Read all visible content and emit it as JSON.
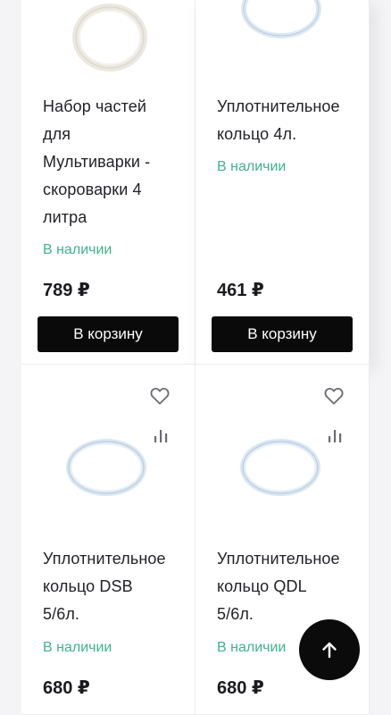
{
  "products": [
    {
      "title": "Набор частей для Мультиварки - скороварки 4 литра",
      "title_lines": [
        "Набор частей",
        "для",
        "Мультиварки -",
        "скороварки 4",
        "литра"
      ],
      "stock": "В наличии",
      "price": "789 ₽",
      "button": "В корзину",
      "image_icon": "seal-ring-icon"
    },
    {
      "title": "Уплотнительное кольцо 4л.",
      "title_lines": [
        "Уплотнительное",
        "кольцо 4л."
      ],
      "stock": "В наличии",
      "price": "461 ₽",
      "button": "В корзину",
      "image_icon": "seal-ring-icon"
    },
    {
      "title": "Уплотнительное кольцо DSB 5/6л.",
      "title_lines": [
        "Уплотнительное",
        "кольцо DSB",
        "5/6л."
      ],
      "stock": "В наличии",
      "price": "680 ₽",
      "image_icon": "seal-ring-icon"
    },
    {
      "title": "Уплотнительное кольцо QDL 5/6л.",
      "title_lines": [
        "Уплотнительное",
        "кольцо QDL",
        "5/6л."
      ],
      "stock": "В наличии",
      "price": "680 ₽",
      "image_icon": "seal-ring-icon"
    }
  ],
  "icons": {
    "favorite": "heart-icon",
    "compare": "bar-chart-icon",
    "scroll_top": "arrow-up-icon"
  },
  "colors": {
    "in_stock": "#3fb389",
    "button_bg": "#0a0a0a",
    "button_text": "#ffffff"
  }
}
